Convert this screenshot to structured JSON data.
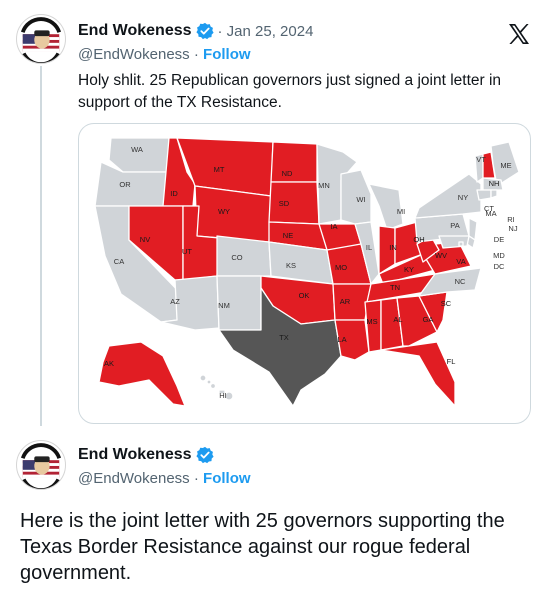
{
  "tweet1": {
    "display_name": "End Wokeness",
    "date": "· Jan 25, 2024",
    "handle": "@EndWokeness",
    "separator": " · ",
    "follow": "Follow",
    "text": "Holy shlit. 25 Republican governors just signed a joint letter in support of the TX Resistance."
  },
  "tweet2": {
    "display_name": "End Wokeness",
    "handle": "@EndWokeness",
    "separator": " · ",
    "follow": "Follow",
    "text": "Here is the joint letter with 25 governors supporting the Texas Border Resistance against our rogue federal government."
  },
  "avatar": {
    "badge_text_top": "I SUPPORT THE",
    "badge_text_bottom": "FARMER TRUCKS"
  },
  "map": {
    "colors": {
      "republican": "#e11d23",
      "other": "#d0d4d8",
      "texas": "#565656",
      "border": "#ffffff"
    },
    "state_labels": {
      "WA": "WA",
      "OR": "OR",
      "CA": "CA",
      "ID": "ID",
      "NV": "NV",
      "MT": "MT",
      "WY": "WY",
      "UT": "UT",
      "AZ": "AZ",
      "CO": "CO",
      "NM": "NM",
      "ND": "ND",
      "SD": "SD",
      "NE": "NE",
      "KS": "KS",
      "OK": "OK",
      "TX": "TX",
      "MN": "MN",
      "IA": "IA",
      "MO": "MO",
      "AR": "AR",
      "LA": "LA",
      "WI": "WI",
      "IL": "IL",
      "MI": "MI",
      "IN": "IN",
      "OH": "OH",
      "KY": "KY",
      "TN": "TN",
      "MS": "MS",
      "AL": "AL",
      "GA": "GA",
      "FL": "FL",
      "SC": "SC",
      "NC": "NC",
      "VA": "VA",
      "WV": "WV",
      "PA": "PA",
      "NY": "NY",
      "VT": "VT",
      "NH": "NH",
      "ME": "ME",
      "MA": "MA",
      "CT": "CT",
      "RI": "RI",
      "NJ": "NJ",
      "DE": "DE",
      "MD": "MD",
      "DC": "DC",
      "AK": "AK",
      "HI": "HI"
    }
  }
}
